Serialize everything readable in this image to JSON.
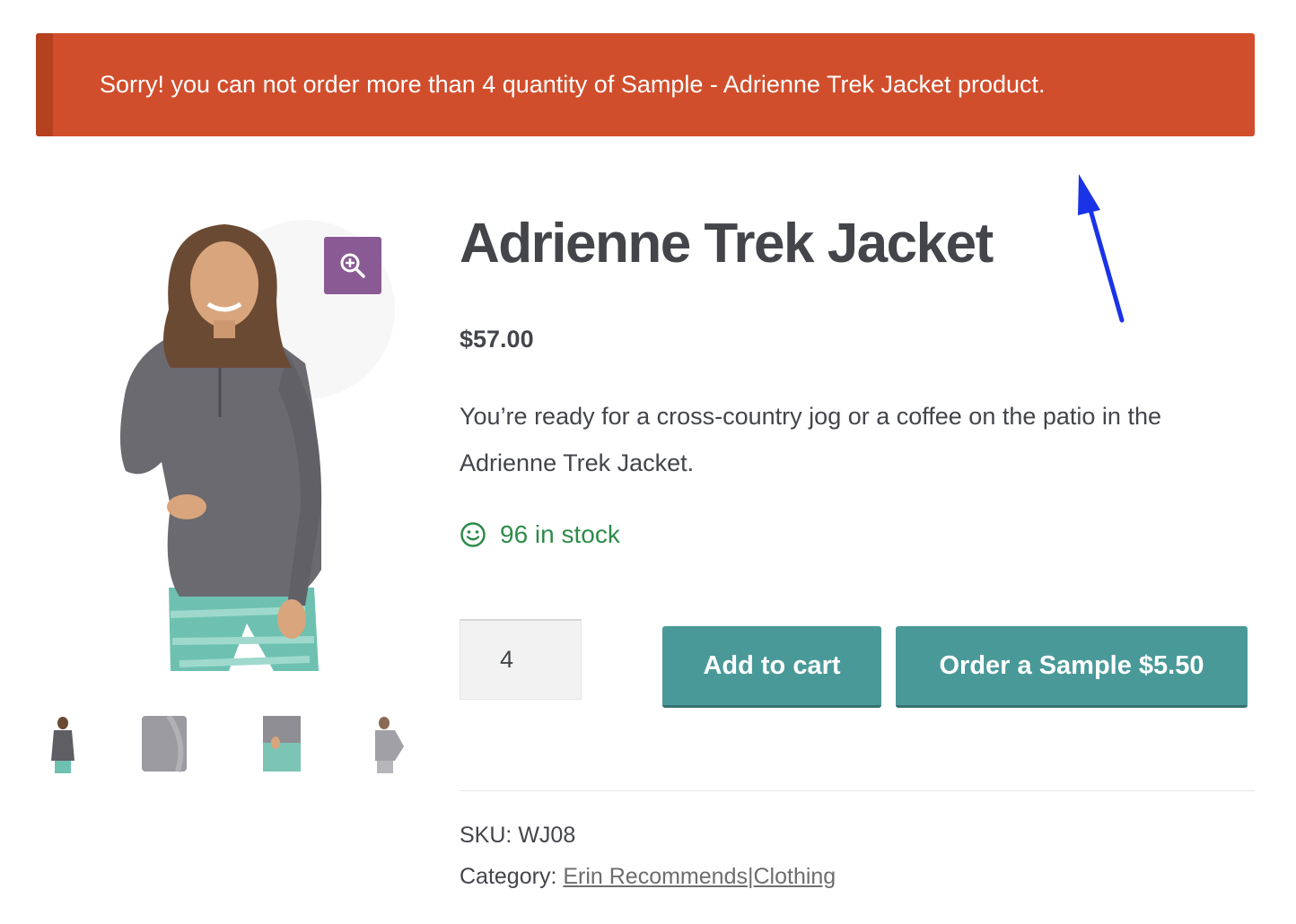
{
  "notice": {
    "message": "Sorry! you can not order more than 4 quantity of Sample - Adrienne Trek Jacket product.",
    "color": "#d14e2c"
  },
  "product": {
    "title": "Adrienne Trek Jacket",
    "price": "$57.00",
    "description": "You’re ready for a cross-country jog or a coffee on the patio in the Adrienne Trek Jacket.",
    "stock": "96 in stock",
    "quantity": "4",
    "add_to_cart_label": "Add to cart",
    "order_sample_label": "Order a Sample $5.50",
    "sku_label": "SKU:",
    "sku": "WJ08",
    "category_label": "Category:",
    "categories": [
      "Erin Recommends",
      "Clothing"
    ],
    "category_separator": "|"
  },
  "icons": {
    "zoom": "magnify-plus-icon",
    "stock": "smiley-icon",
    "annotation": "blue-arrow"
  },
  "colors": {
    "button": "#4a9999",
    "zoom_button": "#8a5a94",
    "stock": "#2e8b4a",
    "arrow": "#1a33e6"
  }
}
